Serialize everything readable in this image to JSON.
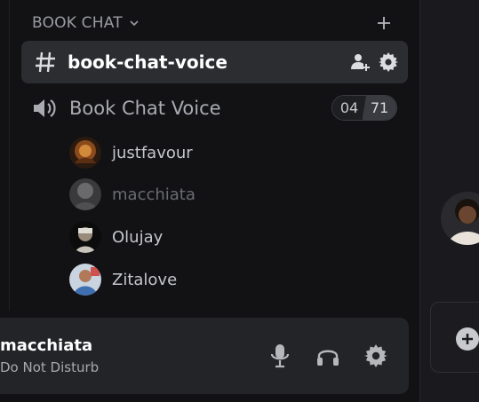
{
  "category": {
    "label": "BOOK CHAT",
    "chevron_icon": "chevron-down-icon",
    "add_icon": "plus-icon"
  },
  "text_channel": {
    "name": "book-chat-voice",
    "icon": "hash-icon",
    "actions": [
      "add-member-icon",
      "gear-icon"
    ]
  },
  "voice_channel": {
    "name": "Book Chat Voice",
    "icon": "speaker-icon",
    "user_count": "04",
    "user_limit": "71",
    "users": [
      {
        "name": "justfavour",
        "muted_style": false
      },
      {
        "name": "macchiata",
        "muted_style": true
      },
      {
        "name": "Olujay",
        "muted_style": false
      },
      {
        "name": "Zitalove",
        "muted_style": false
      }
    ]
  },
  "user_panel": {
    "username": "macchiata",
    "status": "Do Not Disturb",
    "buttons": [
      "microphone-icon",
      "headphones-icon",
      "gear-icon"
    ]
  },
  "colors": {
    "background": "#121214",
    "active_channel": "#2c2d31",
    "panel": "#232428"
  }
}
